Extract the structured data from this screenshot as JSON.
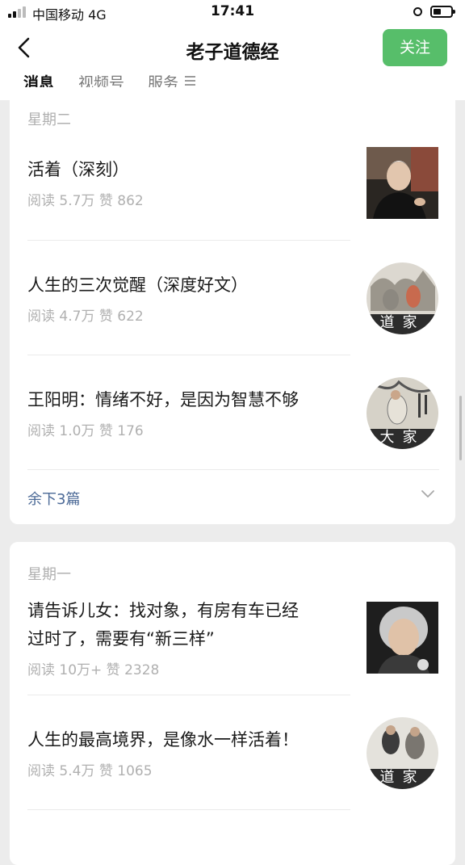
{
  "status_bar": {
    "carrier": "中国移动 4G",
    "time": "17:41"
  },
  "header": {
    "title": "老子道德经",
    "follow_label": "关注"
  },
  "tabs": [
    {
      "label": "消息"
    },
    {
      "label": "视频号"
    },
    {
      "label": "服务"
    }
  ],
  "groups": [
    {
      "day": "星期二",
      "articles": [
        {
          "title": "活着（深刻）",
          "meta": "阅读 5.7万  赞 862"
        },
        {
          "title": "人生的三次觉醒（深度好文）",
          "meta": "阅读 4.7万  赞 622"
        },
        {
          "title": "王阳明：情绪不好，是因为智慧不够",
          "meta": "阅读 1.0万  赞 176",
          "thumb_text": "大家"
        }
      ],
      "more_label": "余下3篇"
    },
    {
      "day": "星期一",
      "articles": [
        {
          "title_line1": "请告诉儿女：找对象，有房有车已经",
          "title_line2": "过时了，需要有“新三样”",
          "meta": "阅读 10万+  赞 2328"
        },
        {
          "title": "人生的最高境界，是像水一样活着！",
          "meta": "阅读 5.4万  赞 1065"
        }
      ]
    }
  ],
  "thumb_label_daojia": "道家",
  "colors": {
    "follow_button": "#57be6a",
    "more_link": "#4c6a97",
    "meta_text": "#b0b0b0"
  }
}
